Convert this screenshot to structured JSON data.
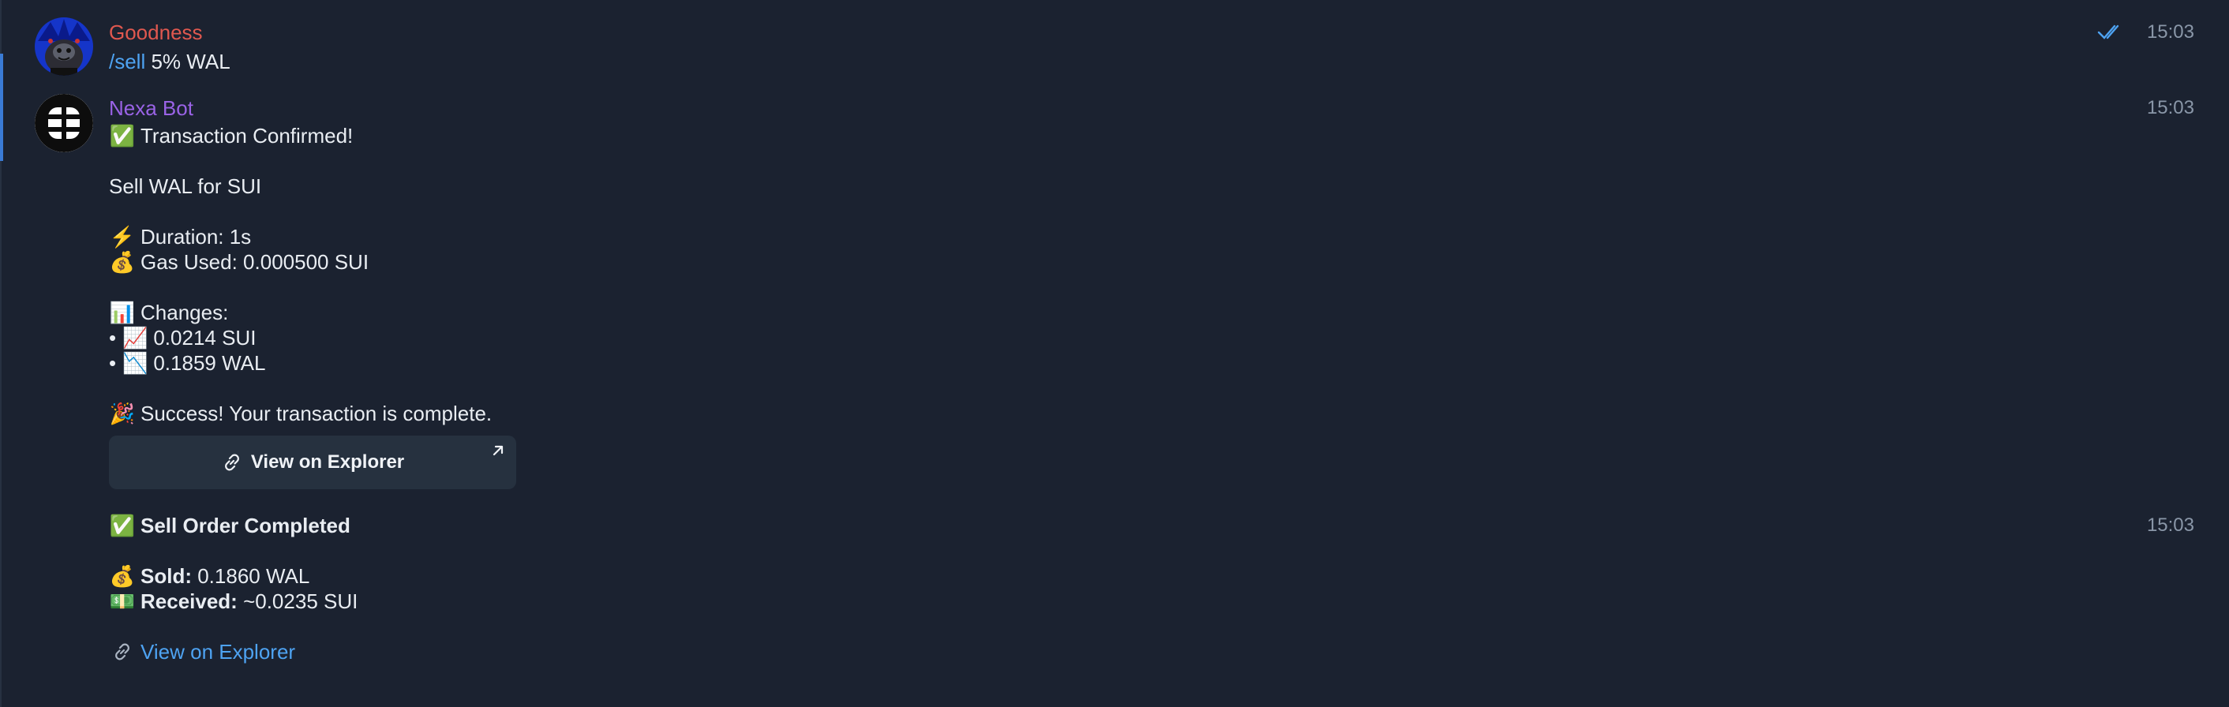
{
  "messages": [
    {
      "sender": "Goodness",
      "time": "15:03",
      "command": "/sell",
      "text": " 5% WAL"
    },
    {
      "sender": "Nexa Bot",
      "time": "15:03",
      "lines": {
        "confirmed": "Transaction Confirmed!",
        "title": "Sell WAL for SUI",
        "duration": "Duration: 1s",
        "gas": "Gas Used: 0.000500 SUI",
        "changes": "Changes:",
        "change1": "0.0214 SUI",
        "change2": "0.1859 WAL",
        "success": "Success! Your transaction is complete."
      },
      "button_label": "View on Explorer"
    },
    {
      "time": "15:03",
      "title": "Sell Order Completed",
      "sold_label": "Sold:",
      "sold_value": " 0.1860 WAL",
      "received_label": "Received:",
      "received_value": " ~0.0235 SUI",
      "link_label": "View on Explorer"
    }
  ],
  "emoji": {
    "check": "✅",
    "bolt": "⚡",
    "money_bag": "💰",
    "chart": "📊",
    "bullet": "•",
    "trend_up": "📈",
    "trend_down": "📉",
    "party": "🎉",
    "cash": "💵"
  },
  "colors": {
    "background": "#1b2230",
    "sender_goodness": "#e0584f",
    "sender_bot": "#9a63e6",
    "link": "#4ea3f2",
    "timestamp": "#8a97a8"
  }
}
